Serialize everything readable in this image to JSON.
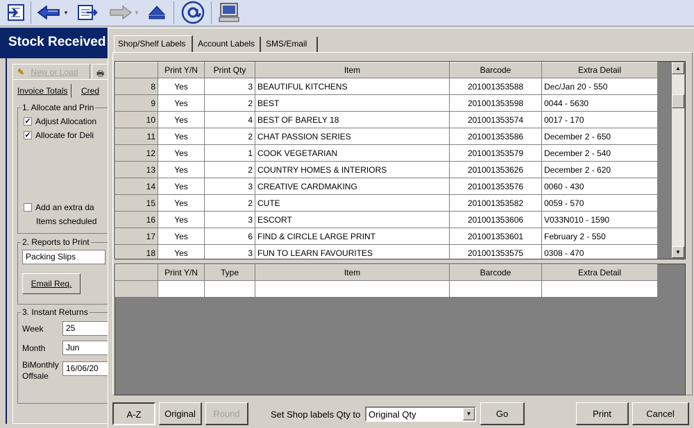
{
  "toolbar": {
    "buttons": [
      {
        "name": "exit-to-icon"
      },
      {
        "name": "back-arrow-icon"
      },
      {
        "name": "edit-document-icon"
      },
      {
        "name": "forward-arrow-icon"
      },
      {
        "name": "eject-icon"
      },
      {
        "name": "email-at-icon"
      },
      {
        "name": "computer-icon"
      }
    ]
  },
  "main_window": {
    "title": "Stock Received",
    "tab_new_or_load": "New or Load",
    "subtab_invoice_totals": "Invoice Totals",
    "subtab_cred": "Cred",
    "group1_title": "1. Allocate and Prin",
    "chk_adjust_allocation": "Adjust Allocation",
    "chk_allocate_for_deli": "Allocate for Deli",
    "chk_add_extra": "Add an extra da",
    "items_scheduled": "Items scheduled",
    "group2_title": "2. Reports to Print",
    "reports_value": "Packing Slips",
    "email_req": "Email Req.",
    "group3_title": "3. Instant Returns",
    "week_label": "Week",
    "week_value": "25",
    "month_label": "Month",
    "month_value": "Jun",
    "bimonthly_label_1": "BiMonthly",
    "bimonthly_label_2": "Offsale",
    "bimonthly_value": "16/06/20"
  },
  "dialog": {
    "tabs": [
      "Shop/Shelf Labels",
      "Account Labels",
      "SMS/Email"
    ],
    "active_tab": "Shop/Shelf Labels",
    "upper_grid": {
      "columns": [
        "Print Y/N",
        "Print Qty",
        "Item",
        "Barcode",
        "Extra Detail"
      ],
      "rows": [
        {
          "num": "8",
          "print": "Yes",
          "qty": "3",
          "item": "BEAUTIFUL KITCHENS",
          "barcode": "201001353588",
          "extra": "Dec/Jan 20 - 550"
        },
        {
          "num": "9",
          "print": "Yes",
          "qty": "2",
          "item": "BEST",
          "barcode": "201001353598",
          "extra": "0044 - 5630"
        },
        {
          "num": "10",
          "print": "Yes",
          "qty": "4",
          "item": "BEST OF BARELY 18",
          "barcode": "201001353574",
          "extra": "0017 - 170"
        },
        {
          "num": "11",
          "print": "Yes",
          "qty": "2",
          "item": "CHAT PASSION SERIES",
          "barcode": "201001353586",
          "extra": "December 2 - 650"
        },
        {
          "num": "12",
          "print": "Yes",
          "qty": "1",
          "item": "COOK VEGETARIAN",
          "barcode": "201001353579",
          "extra": "December 2 - 540"
        },
        {
          "num": "13",
          "print": "Yes",
          "qty": "2",
          "item": "COUNTRY HOMES & INTERIORS",
          "barcode": "201001353626",
          "extra": "December 2 - 620"
        },
        {
          "num": "14",
          "print": "Yes",
          "qty": "3",
          "item": "CREATIVE CARDMAKING",
          "barcode": "201001353576",
          "extra": "0060 - 430"
        },
        {
          "num": "15",
          "print": "Yes",
          "qty": "2",
          "item": "CUTE",
          "barcode": "201001353582",
          "extra": "0059 - 570"
        },
        {
          "num": "16",
          "print": "Yes",
          "qty": "3",
          "item": "ESCORT",
          "barcode": "201001353606",
          "extra": "V033N010 - 1590"
        },
        {
          "num": "17",
          "print": "Yes",
          "qty": "6",
          "item": "FIND & CIRCLE LARGE PRINT",
          "barcode": "201001353601",
          "extra": "February 2 - 550"
        },
        {
          "num": "18",
          "print": "Yes",
          "qty": "3",
          "item": "FUN TO LEARN FAVOURITES",
          "barcode": "201001353575",
          "extra": "0308 - 470"
        }
      ]
    },
    "lower_grid": {
      "columns": [
        "Print Y/N",
        "Type",
        "Item",
        "Barcode",
        "Extra Detail"
      ]
    },
    "bottom": {
      "az_label": "A-Z",
      "original_label": "Original",
      "round_label": "Round",
      "set_qty_label": "Set Shop labels Qty to",
      "qty_select_value": "Original Qty",
      "go_label": "Go",
      "print_label": "Print",
      "cancel_label": "Cancel"
    }
  }
}
